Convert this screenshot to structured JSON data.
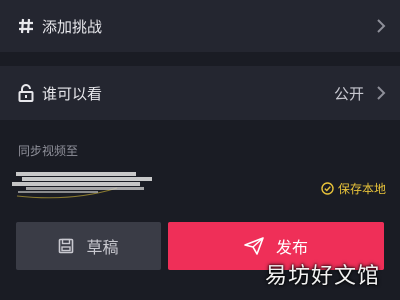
{
  "challenge_row": {
    "label": "添加挑战",
    "icon": "hashtag-icon"
  },
  "visibility_row": {
    "label": "谁可以看",
    "value": "公开",
    "icon": "unlock-icon"
  },
  "sync": {
    "title": "同步视频至"
  },
  "save_local": {
    "label": "保存本地",
    "icon": "check-circle-icon"
  },
  "buttons": {
    "draft": "草稿",
    "publish": "发布"
  },
  "watermark": "易坊好文馆",
  "colors": {
    "accent": "#ef2f58",
    "save_local": "#e7c23a",
    "background": "#1a1c24",
    "row": "#242630"
  }
}
